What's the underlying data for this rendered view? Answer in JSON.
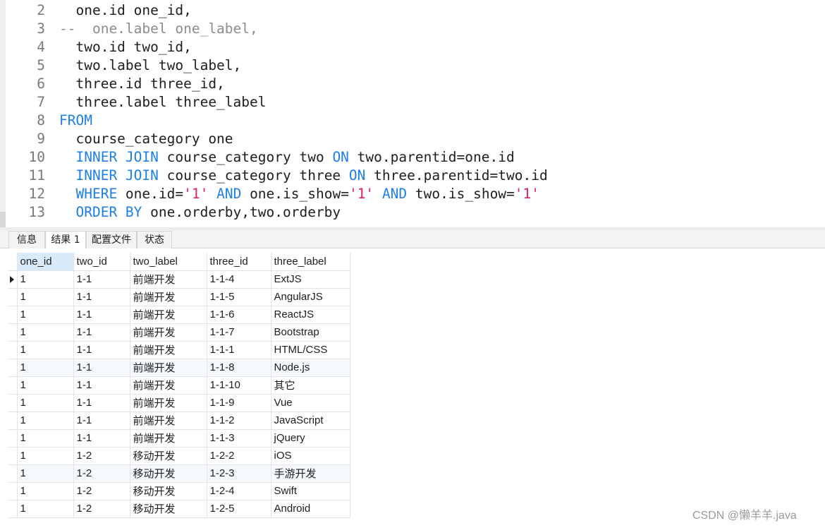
{
  "editor": {
    "lines": [
      {
        "num": "2",
        "tokens": [
          {
            "t": "  one.id one_id,",
            "c": "plain"
          }
        ]
      },
      {
        "num": "3",
        "tokens": [
          {
            "t": "--  one.label one_label,",
            "c": "cmt"
          }
        ]
      },
      {
        "num": "4",
        "tokens": [
          {
            "t": "  two.id two_id,",
            "c": "plain"
          }
        ]
      },
      {
        "num": "5",
        "tokens": [
          {
            "t": "  two.label two_label,",
            "c": "plain"
          }
        ]
      },
      {
        "num": "6",
        "tokens": [
          {
            "t": "  three.id three_id,",
            "c": "plain"
          }
        ]
      },
      {
        "num": "7",
        "tokens": [
          {
            "t": "  three.label three_label",
            "c": "plain"
          }
        ]
      },
      {
        "num": "8",
        "tokens": [
          {
            "t": "FROM",
            "c": "kw"
          }
        ]
      },
      {
        "num": "9",
        "tokens": [
          {
            "t": "  course_category one",
            "c": "plain"
          }
        ]
      },
      {
        "num": "10",
        "tokens": [
          {
            "t": "  ",
            "c": "plain"
          },
          {
            "t": "INNER JOIN",
            "c": "kw"
          },
          {
            "t": " course_category two ",
            "c": "plain"
          },
          {
            "t": "ON",
            "c": "kw"
          },
          {
            "t": " two.parentid=one.id",
            "c": "plain"
          }
        ]
      },
      {
        "num": "11",
        "tokens": [
          {
            "t": "  ",
            "c": "plain"
          },
          {
            "t": "INNER JOIN",
            "c": "kw"
          },
          {
            "t": " course_category three ",
            "c": "plain"
          },
          {
            "t": "ON",
            "c": "kw"
          },
          {
            "t": " three.parentid=two.id",
            "c": "plain"
          }
        ]
      },
      {
        "num": "12",
        "tokens": [
          {
            "t": "  ",
            "c": "plain"
          },
          {
            "t": "WHERE",
            "c": "kw"
          },
          {
            "t": " one.id=",
            "c": "plain"
          },
          {
            "t": "'1'",
            "c": "str"
          },
          {
            "t": " ",
            "c": "plain"
          },
          {
            "t": "AND",
            "c": "kw"
          },
          {
            "t": " one.is_show=",
            "c": "plain"
          },
          {
            "t": "'1'",
            "c": "str"
          },
          {
            "t": " ",
            "c": "plain"
          },
          {
            "t": "AND",
            "c": "kw"
          },
          {
            "t": " two.is_show=",
            "c": "plain"
          },
          {
            "t": "'1'",
            "c": "str"
          }
        ]
      },
      {
        "num": "13",
        "tokens": [
          {
            "t": "  ",
            "c": "plain"
          },
          {
            "t": "ORDER BY",
            "c": "kw"
          },
          {
            "t": " one.orderby,two.orderby",
            "c": "plain"
          }
        ]
      }
    ]
  },
  "tabs": [
    {
      "label": "信息",
      "active": false
    },
    {
      "label": "结果 1",
      "active": true
    },
    {
      "label": "配置文件",
      "active": false
    },
    {
      "label": "状态",
      "active": false
    }
  ],
  "grid": {
    "columns": [
      "one_id",
      "two_id",
      "two_label",
      "three_id",
      "three_label"
    ],
    "rows": [
      [
        "1",
        "1-1",
        "前端开发",
        "1-1-4",
        "ExtJS"
      ],
      [
        "1",
        "1-1",
        "前端开发",
        "1-1-5",
        "AngularJS"
      ],
      [
        "1",
        "1-1",
        "前端开发",
        "1-1-6",
        "ReactJS"
      ],
      [
        "1",
        "1-1",
        "前端开发",
        "1-1-7",
        "Bootstrap"
      ],
      [
        "1",
        "1-1",
        "前端开发",
        "1-1-1",
        "HTML/CSS"
      ],
      [
        "1",
        "1-1",
        "前端开发",
        "1-1-8",
        "Node.js"
      ],
      [
        "1",
        "1-1",
        "前端开发",
        "1-1-10",
        "其它"
      ],
      [
        "1",
        "1-1",
        "前端开发",
        "1-1-9",
        "Vue"
      ],
      [
        "1",
        "1-1",
        "前端开发",
        "1-1-2",
        "JavaScript"
      ],
      [
        "1",
        "1-1",
        "前端开发",
        "1-1-3",
        "jQuery"
      ],
      [
        "1",
        "1-2",
        "移动开发",
        "1-2-2",
        "iOS"
      ],
      [
        "1",
        "1-2",
        "移动开发",
        "1-2-3",
        "手游开发"
      ],
      [
        "1",
        "1-2",
        "移动开发",
        "1-2-4",
        "Swift"
      ],
      [
        "1",
        "1-2",
        "移动开发",
        "1-2-5",
        "Android"
      ]
    ]
  },
  "watermark": "CSDN @懒羊羊.java"
}
